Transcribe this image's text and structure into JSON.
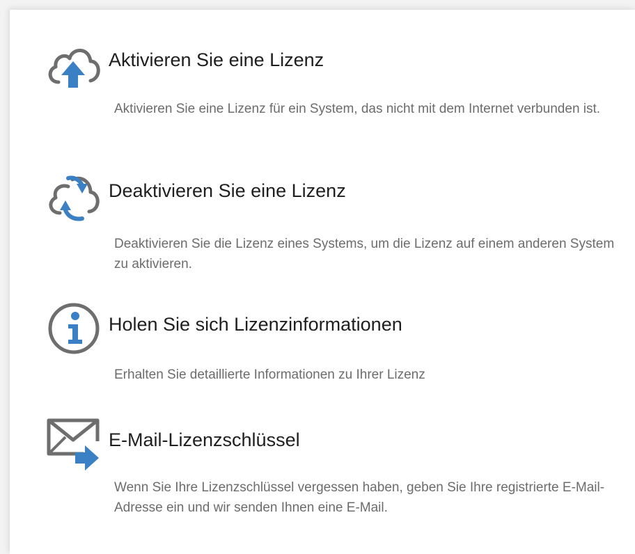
{
  "colors": {
    "accent_blue": "#3b7fc4",
    "icon_gray": "#6e6e6e",
    "title_text": "#1f1f1f",
    "desc_text": "#6c6c6c"
  },
  "options": [
    {
      "icon": "cloud-upload-icon",
      "title": "Aktivieren Sie eine Lizenz",
      "description": "Aktivieren Sie eine Lizenz für ein System, das nicht mit dem Internet verbunden ist."
    },
    {
      "icon": "cloud-sync-icon",
      "title": "Deaktivieren Sie eine Lizenz",
      "description": "Deaktivieren Sie die Lizenz eines Systems, um die Lizenz auf einem anderen System zu aktivieren."
    },
    {
      "icon": "info-icon",
      "title": "Holen Sie sich Lizenzinformationen",
      "description": "Erhalten Sie detaillierte Informationen zu Ihrer Lizenz"
    },
    {
      "icon": "email-forward-icon",
      "title": "E-Mail-Lizenzschlüssel",
      "description": "Wenn Sie Ihre Lizenzschlüssel vergessen haben, geben Sie Ihre registrierte E-Mail-Adresse ein und wir senden Ihnen eine E-Mail."
    }
  ]
}
